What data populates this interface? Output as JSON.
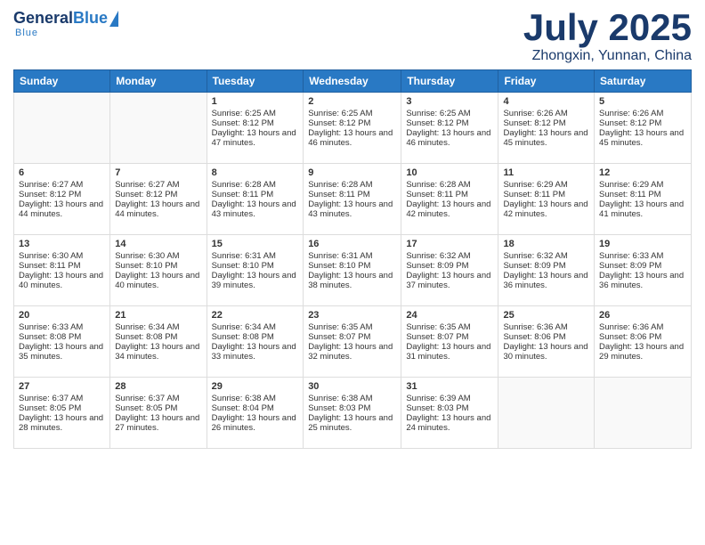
{
  "logo": {
    "general": "General",
    "blue": "Blue",
    "underline": "Blue"
  },
  "header": {
    "title": "July 2025",
    "location": "Zhongxin, Yunnan, China"
  },
  "weekdays": [
    "Sunday",
    "Monday",
    "Tuesday",
    "Wednesday",
    "Thursday",
    "Friday",
    "Saturday"
  ],
  "weeks": [
    [
      {
        "day": "",
        "content": ""
      },
      {
        "day": "",
        "content": ""
      },
      {
        "day": "1",
        "content": "Sunrise: 6:25 AM\nSunset: 8:12 PM\nDaylight: 13 hours and 47 minutes."
      },
      {
        "day": "2",
        "content": "Sunrise: 6:25 AM\nSunset: 8:12 PM\nDaylight: 13 hours and 46 minutes."
      },
      {
        "day": "3",
        "content": "Sunrise: 6:25 AM\nSunset: 8:12 PM\nDaylight: 13 hours and 46 minutes."
      },
      {
        "day": "4",
        "content": "Sunrise: 6:26 AM\nSunset: 8:12 PM\nDaylight: 13 hours and 45 minutes."
      },
      {
        "day": "5",
        "content": "Sunrise: 6:26 AM\nSunset: 8:12 PM\nDaylight: 13 hours and 45 minutes."
      }
    ],
    [
      {
        "day": "6",
        "content": "Sunrise: 6:27 AM\nSunset: 8:12 PM\nDaylight: 13 hours and 44 minutes."
      },
      {
        "day": "7",
        "content": "Sunrise: 6:27 AM\nSunset: 8:12 PM\nDaylight: 13 hours and 44 minutes."
      },
      {
        "day": "8",
        "content": "Sunrise: 6:28 AM\nSunset: 8:11 PM\nDaylight: 13 hours and 43 minutes."
      },
      {
        "day": "9",
        "content": "Sunrise: 6:28 AM\nSunset: 8:11 PM\nDaylight: 13 hours and 43 minutes."
      },
      {
        "day": "10",
        "content": "Sunrise: 6:28 AM\nSunset: 8:11 PM\nDaylight: 13 hours and 42 minutes."
      },
      {
        "day": "11",
        "content": "Sunrise: 6:29 AM\nSunset: 8:11 PM\nDaylight: 13 hours and 42 minutes."
      },
      {
        "day": "12",
        "content": "Sunrise: 6:29 AM\nSunset: 8:11 PM\nDaylight: 13 hours and 41 minutes."
      }
    ],
    [
      {
        "day": "13",
        "content": "Sunrise: 6:30 AM\nSunset: 8:11 PM\nDaylight: 13 hours and 40 minutes."
      },
      {
        "day": "14",
        "content": "Sunrise: 6:30 AM\nSunset: 8:10 PM\nDaylight: 13 hours and 40 minutes."
      },
      {
        "day": "15",
        "content": "Sunrise: 6:31 AM\nSunset: 8:10 PM\nDaylight: 13 hours and 39 minutes."
      },
      {
        "day": "16",
        "content": "Sunrise: 6:31 AM\nSunset: 8:10 PM\nDaylight: 13 hours and 38 minutes."
      },
      {
        "day": "17",
        "content": "Sunrise: 6:32 AM\nSunset: 8:09 PM\nDaylight: 13 hours and 37 minutes."
      },
      {
        "day": "18",
        "content": "Sunrise: 6:32 AM\nSunset: 8:09 PM\nDaylight: 13 hours and 36 minutes."
      },
      {
        "day": "19",
        "content": "Sunrise: 6:33 AM\nSunset: 8:09 PM\nDaylight: 13 hours and 36 minutes."
      }
    ],
    [
      {
        "day": "20",
        "content": "Sunrise: 6:33 AM\nSunset: 8:08 PM\nDaylight: 13 hours and 35 minutes."
      },
      {
        "day": "21",
        "content": "Sunrise: 6:34 AM\nSunset: 8:08 PM\nDaylight: 13 hours and 34 minutes."
      },
      {
        "day": "22",
        "content": "Sunrise: 6:34 AM\nSunset: 8:08 PM\nDaylight: 13 hours and 33 minutes."
      },
      {
        "day": "23",
        "content": "Sunrise: 6:35 AM\nSunset: 8:07 PM\nDaylight: 13 hours and 32 minutes."
      },
      {
        "day": "24",
        "content": "Sunrise: 6:35 AM\nSunset: 8:07 PM\nDaylight: 13 hours and 31 minutes."
      },
      {
        "day": "25",
        "content": "Sunrise: 6:36 AM\nSunset: 8:06 PM\nDaylight: 13 hours and 30 minutes."
      },
      {
        "day": "26",
        "content": "Sunrise: 6:36 AM\nSunset: 8:06 PM\nDaylight: 13 hours and 29 minutes."
      }
    ],
    [
      {
        "day": "27",
        "content": "Sunrise: 6:37 AM\nSunset: 8:05 PM\nDaylight: 13 hours and 28 minutes."
      },
      {
        "day": "28",
        "content": "Sunrise: 6:37 AM\nSunset: 8:05 PM\nDaylight: 13 hours and 27 minutes."
      },
      {
        "day": "29",
        "content": "Sunrise: 6:38 AM\nSunset: 8:04 PM\nDaylight: 13 hours and 26 minutes."
      },
      {
        "day": "30",
        "content": "Sunrise: 6:38 AM\nSunset: 8:03 PM\nDaylight: 13 hours and 25 minutes."
      },
      {
        "day": "31",
        "content": "Sunrise: 6:39 AM\nSunset: 8:03 PM\nDaylight: 13 hours and 24 minutes."
      },
      {
        "day": "",
        "content": ""
      },
      {
        "day": "",
        "content": ""
      }
    ]
  ]
}
